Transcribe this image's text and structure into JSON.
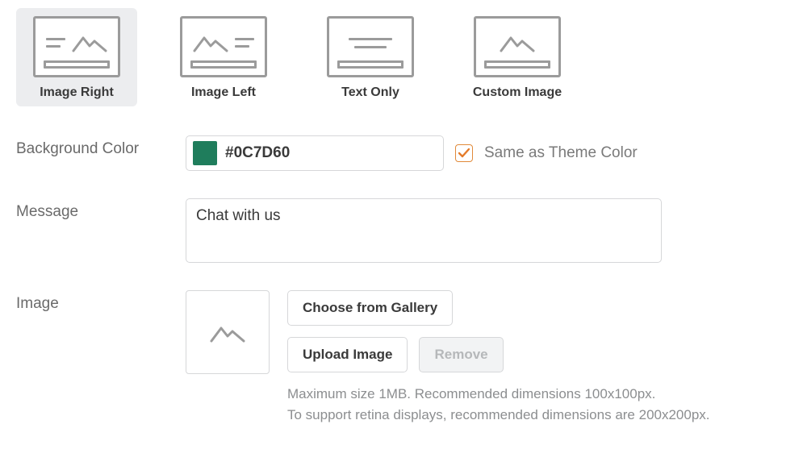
{
  "layoutTiles": [
    {
      "label": "Image Right"
    },
    {
      "label": "Image Left"
    },
    {
      "label": "Text Only"
    },
    {
      "label": "Custom Image"
    }
  ],
  "fields": {
    "backgroundColor": {
      "label": "Background Color",
      "value": "#0C7D60",
      "swatch": "#1f7d5c",
      "sameAsTheme": {
        "label": "Same as Theme Color",
        "checked": true
      }
    },
    "message": {
      "label": "Message",
      "value": "Chat with us"
    },
    "image": {
      "label": "Image",
      "buttons": {
        "chooseGallery": "Choose from Gallery",
        "upload": "Upload Image",
        "remove": "Remove"
      },
      "hint1": "Maximum size 1MB. Recommended dimensions 100x100px.",
      "hint2": "To support retina displays, recommended dimensions are 200x200px."
    }
  }
}
